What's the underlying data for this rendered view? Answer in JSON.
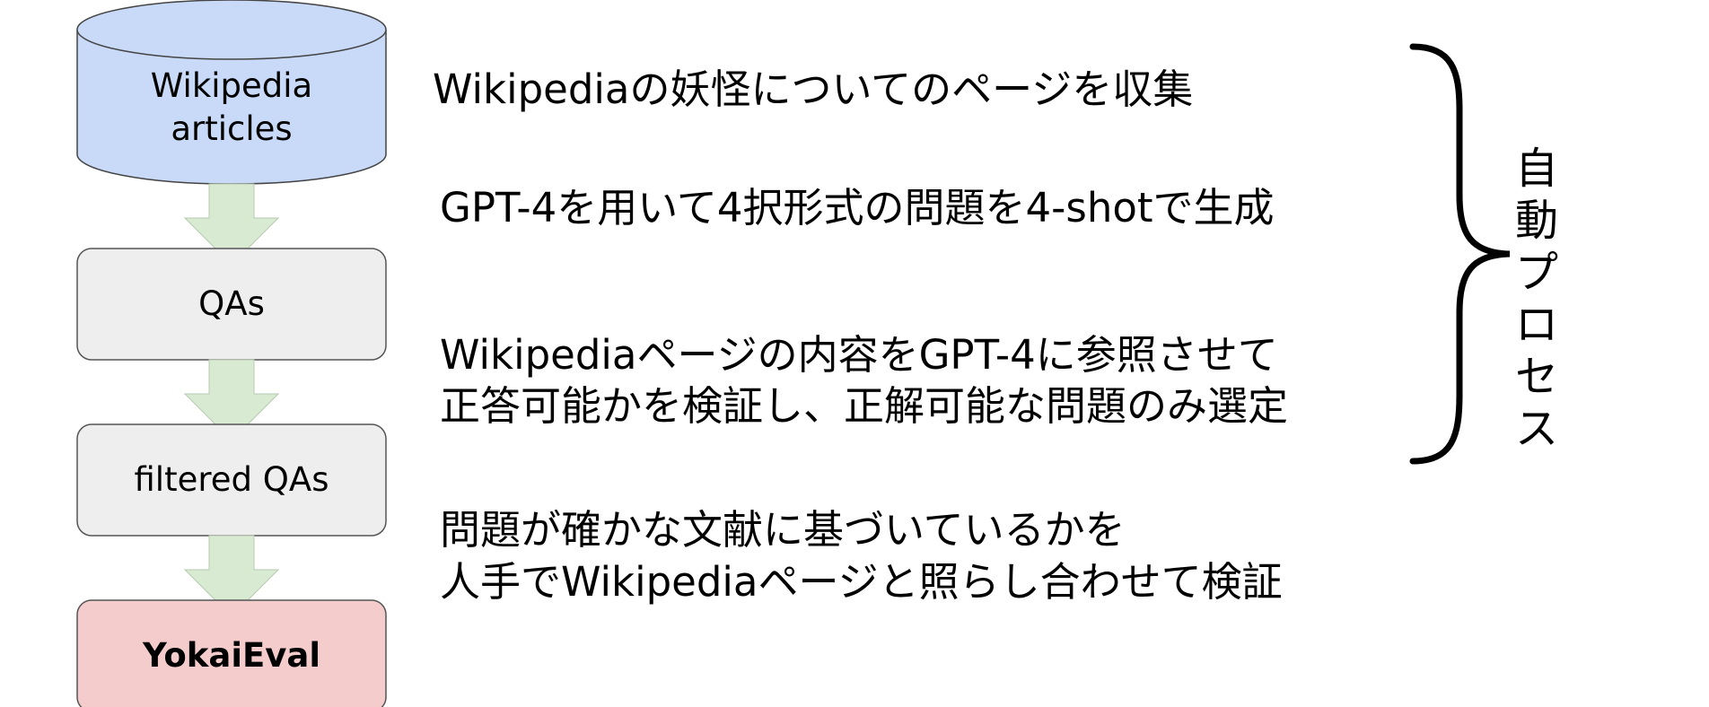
{
  "nodes": {
    "source": {
      "line1": "Wikipedia",
      "line2": "articles",
      "fill": "#c9daf8"
    },
    "qas": {
      "label": "QAs",
      "fill": "#eeeeee"
    },
    "filtered": {
      "label": "filtered QAs",
      "fill": "#eeeeee"
    },
    "result": {
      "label": "YokaiEval",
      "fill": "#f4cccc"
    }
  },
  "arrow_fill": "#d9ead3",
  "steps": [
    {
      "lines": [
        "Wikipediaの妖怪についてのページを収集"
      ]
    },
    {
      "lines": [
        "GPT-4を用いて4択形式の問題を4-shotで生成"
      ]
    },
    {
      "lines": [
        "Wikipediaページの内容をGPT-4に参照させて",
        "正答可能かを検証し、正解可能な問題のみ選定"
      ]
    },
    {
      "lines": [
        "問題が確かな文献に基づいているかを",
        "人手でWikipediaページと照らし合わせて検証"
      ]
    }
  ],
  "process_label": [
    "自",
    "動",
    "プ",
    "ロ",
    "セ",
    "ス"
  ]
}
